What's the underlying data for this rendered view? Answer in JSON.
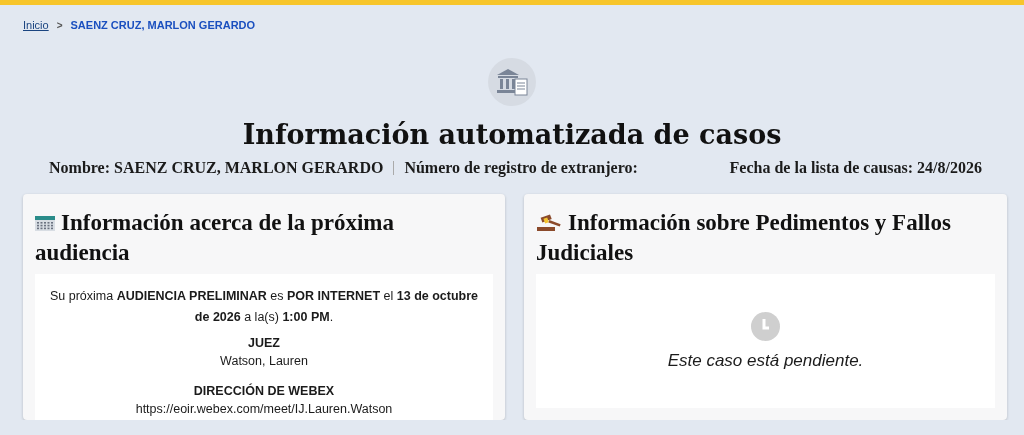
{
  "breadcrumb": {
    "home": "Inicio",
    "separator": ">",
    "current": "SAENZ CRUZ, MARLON GERARDO"
  },
  "title": "Información automatizada de casos",
  "summary": {
    "name": "Nombre: SAENZ CRUZ, MARLON GERARDO",
    "registration_label": "Número de registro de extranjero:",
    "docket_date": "Fecha de la lista de causas: 24/8/2026"
  },
  "cards": [
    {
      "kind": "hearing",
      "heading": "Información acerca de la próxima audiencia",
      "sentence": "Su próxima **AUDIENCIA PRELIMINAR** es **POR INTERNET** el **13 de octubre de 2026** a la(s) **1:00 PM**.",
      "fields": [
        {
          "label": "JUEZ",
          "value": "Watson, Lauren"
        },
        {
          "label": "DIRECCIÓN DE WEBEX",
          "value": "https://eoir.webex.com/meet/IJ.Lauren.Watson"
        }
      ]
    },
    {
      "kind": "status",
      "heading": "Información sobre Pedimentos y Fallos Judiciales",
      "message": "Este caso está pendiente."
    }
  ]
}
